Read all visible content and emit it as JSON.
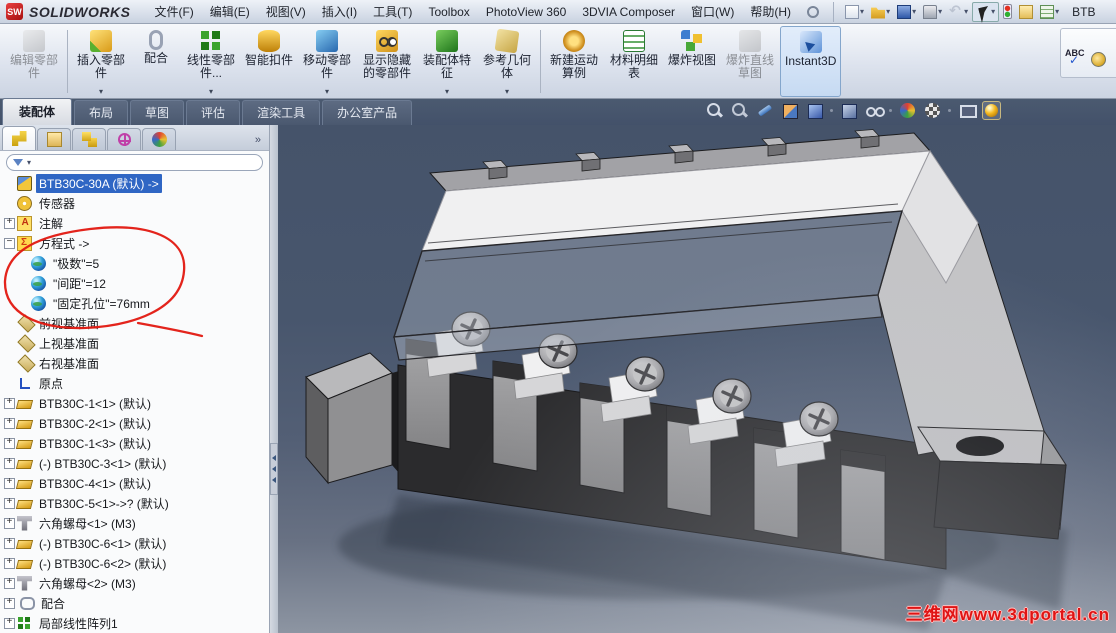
{
  "window": {
    "logo_text": "SW",
    "app_name": "SOLIDWORKS",
    "document_title": "BTB"
  },
  "menu": {
    "items": [
      "文件(F)",
      "编辑(E)",
      "视图(V)",
      "插入(I)",
      "工具(T)",
      "Toolbox",
      "PhotoView 360",
      "3DVIA Composer",
      "窗口(W)",
      "帮助(H)"
    ]
  },
  "quick_access": {
    "buttons": [
      {
        "name": "new-document",
        "arrow": true
      },
      {
        "name": "open",
        "arrow": true
      },
      {
        "name": "save",
        "arrow": true
      },
      {
        "name": "print",
        "arrow": true
      },
      {
        "name": "undo",
        "arrow": true,
        "disabled": true
      },
      {
        "name": "select-arrow",
        "arrow": true,
        "pressed": true
      },
      {
        "name": "traffic-light",
        "arrow": false
      },
      {
        "name": "file-properties",
        "arrow": false
      },
      {
        "name": "task-list",
        "arrow": true
      }
    ]
  },
  "ribbon": {
    "spell_label": "ABC",
    "buttons": [
      {
        "key": "edit-component",
        "label": "编辑零部件",
        "state": "disabled",
        "arrow": false,
        "sep_after": true
      },
      {
        "key": "insert-component",
        "label": "插入零部件",
        "state": "normal",
        "arrow": true
      },
      {
        "key": "mate",
        "label": "配合",
        "state": "normal",
        "arrow": false
      },
      {
        "key": "linear-pattern",
        "label": "线性零部件...",
        "state": "normal",
        "arrow": true
      },
      {
        "key": "smart-fasteners",
        "label": "智能扣件",
        "state": "normal",
        "arrow": false
      },
      {
        "key": "move-component",
        "label": "移动零部件",
        "state": "normal",
        "arrow": true
      },
      {
        "key": "show-hidden",
        "label": "显示隐藏的零部件",
        "state": "normal",
        "arrow": false
      },
      {
        "key": "assembly-features",
        "label": "装配体特征",
        "state": "normal",
        "arrow": true
      },
      {
        "key": "reference-geometry",
        "label": "参考几何体",
        "state": "normal",
        "arrow": true,
        "sep_after": true
      },
      {
        "key": "motion-study",
        "label": "新建运动算例",
        "state": "normal",
        "arrow": false
      },
      {
        "key": "bill-of-materials",
        "label": "材料明细表",
        "state": "normal",
        "arrow": false
      },
      {
        "key": "exploded-view",
        "label": "爆炸视图",
        "state": "normal",
        "arrow": false
      },
      {
        "key": "explode-line-sketch",
        "label": "爆炸直线草图",
        "state": "disabled",
        "arrow": false
      },
      {
        "key": "instant3d",
        "label": "Instant3D",
        "state": "active",
        "arrow": false
      }
    ]
  },
  "command_tabs": {
    "tabs": [
      {
        "key": "assembly",
        "label": "装配体",
        "active": true
      },
      {
        "key": "layout",
        "label": "布局",
        "active": false
      },
      {
        "key": "sketch",
        "label": "草图",
        "active": false
      },
      {
        "key": "evaluate",
        "label": "评估",
        "active": false
      },
      {
        "key": "render-tools",
        "label": "渲染工具",
        "active": false
      },
      {
        "key": "office-products",
        "label": "办公室产品",
        "active": false
      }
    ]
  },
  "hud": {
    "icons": [
      "zoom-fit",
      "zoom-area",
      "previous-view",
      "section-view",
      "view-orientation",
      "display-style",
      "hide-show-items",
      "edit-appearance",
      "apply-scene",
      "view-settings",
      "preview-orb"
    ]
  },
  "panel_tabs": {
    "icons": [
      "feature-manager",
      "property-manager",
      "configuration-manager",
      "dimxpert",
      "display-manager"
    ],
    "overflow": "»"
  },
  "feature_tree": {
    "items": [
      {
        "key": "root",
        "icon": "assembly",
        "label": "BTB30C-30A (默认) ->",
        "expand": null,
        "indent": 0,
        "selected": true
      },
      {
        "key": "sensors",
        "icon": "sensor",
        "label": "传感器",
        "expand": null,
        "indent": 0
      },
      {
        "key": "annotations",
        "icon": "annotation",
        "label": "注解",
        "expand": "plus",
        "indent": 0
      },
      {
        "key": "equations",
        "icon": "equation-folder",
        "label": "方程式 ->",
        "expand": "minus",
        "indent": 0
      },
      {
        "key": "eq-poles",
        "icon": "equation",
        "label": "\"极数\"=5",
        "expand": null,
        "indent": 1
      },
      {
        "key": "eq-pitch",
        "icon": "equation",
        "label": "\"间距\"=12",
        "expand": null,
        "indent": 1
      },
      {
        "key": "eq-mount-hole",
        "icon": "equation",
        "label": "\"固定孔位\"=76mm",
        "expand": null,
        "indent": 1
      },
      {
        "key": "front-plane",
        "icon": "plane",
        "label": "前视基准面",
        "expand": null,
        "indent": 0
      },
      {
        "key": "top-plane",
        "icon": "plane",
        "label": "上视基准面",
        "expand": null,
        "indent": 0
      },
      {
        "key": "right-plane",
        "icon": "plane",
        "label": "右视基准面",
        "expand": null,
        "indent": 0
      },
      {
        "key": "origin",
        "icon": "origin",
        "label": "原点",
        "expand": null,
        "indent": 0
      },
      {
        "key": "btb30c-1-1",
        "icon": "part",
        "label": "BTB30C-1<1> (默认)",
        "expand": "plus",
        "indent": 0
      },
      {
        "key": "btb30c-2-1",
        "icon": "part",
        "label": "BTB30C-2<1> (默认)",
        "expand": "plus",
        "indent": 0
      },
      {
        "key": "btb30c-1-3",
        "icon": "part",
        "label": "BTB30C-1<3> (默认)",
        "expand": "plus",
        "indent": 0
      },
      {
        "key": "btb30c-3-1",
        "icon": "part",
        "label": "(-) BTB30C-3<1> (默认)",
        "expand": "plus",
        "indent": 0
      },
      {
        "key": "btb30c-4-1",
        "icon": "part",
        "label": "BTB30C-4<1> (默认)",
        "expand": "plus",
        "indent": 0
      },
      {
        "key": "btb30c-5-1",
        "icon": "part",
        "label": "BTB30C-5<1>->? (默认)",
        "expand": "plus",
        "indent": 0
      },
      {
        "key": "hex-nut-1",
        "icon": "hex-nut",
        "label": "六角螺母<1> (M3)",
        "expand": "plus",
        "indent": 0
      },
      {
        "key": "btb30c-6-1",
        "icon": "part",
        "label": "(-) BTB30C-6<1> (默认)",
        "expand": "plus",
        "indent": 0
      },
      {
        "key": "btb30c-6-2",
        "icon": "part",
        "label": "(-) BTB30C-6<2> (默认)",
        "expand": "plus",
        "indent": 0
      },
      {
        "key": "hex-nut-2",
        "icon": "hex-nut",
        "label": "六角螺母<2> (M3)",
        "expand": "plus",
        "indent": 0
      },
      {
        "key": "mates",
        "icon": "mate",
        "label": "配合",
        "expand": "plus",
        "indent": 0
      },
      {
        "key": "local-pattern-1",
        "icon": "pattern",
        "label": "局部线性阵列1",
        "expand": "plus",
        "indent": 0
      }
    ]
  },
  "viewport": {
    "watermark": "三维网www.3dportal.cn"
  },
  "colors": {
    "selection": "#2f66c4",
    "annotation_red": "#e21810",
    "viewport_top": "#45536a",
    "viewport_bottom": "#8d95a2"
  }
}
